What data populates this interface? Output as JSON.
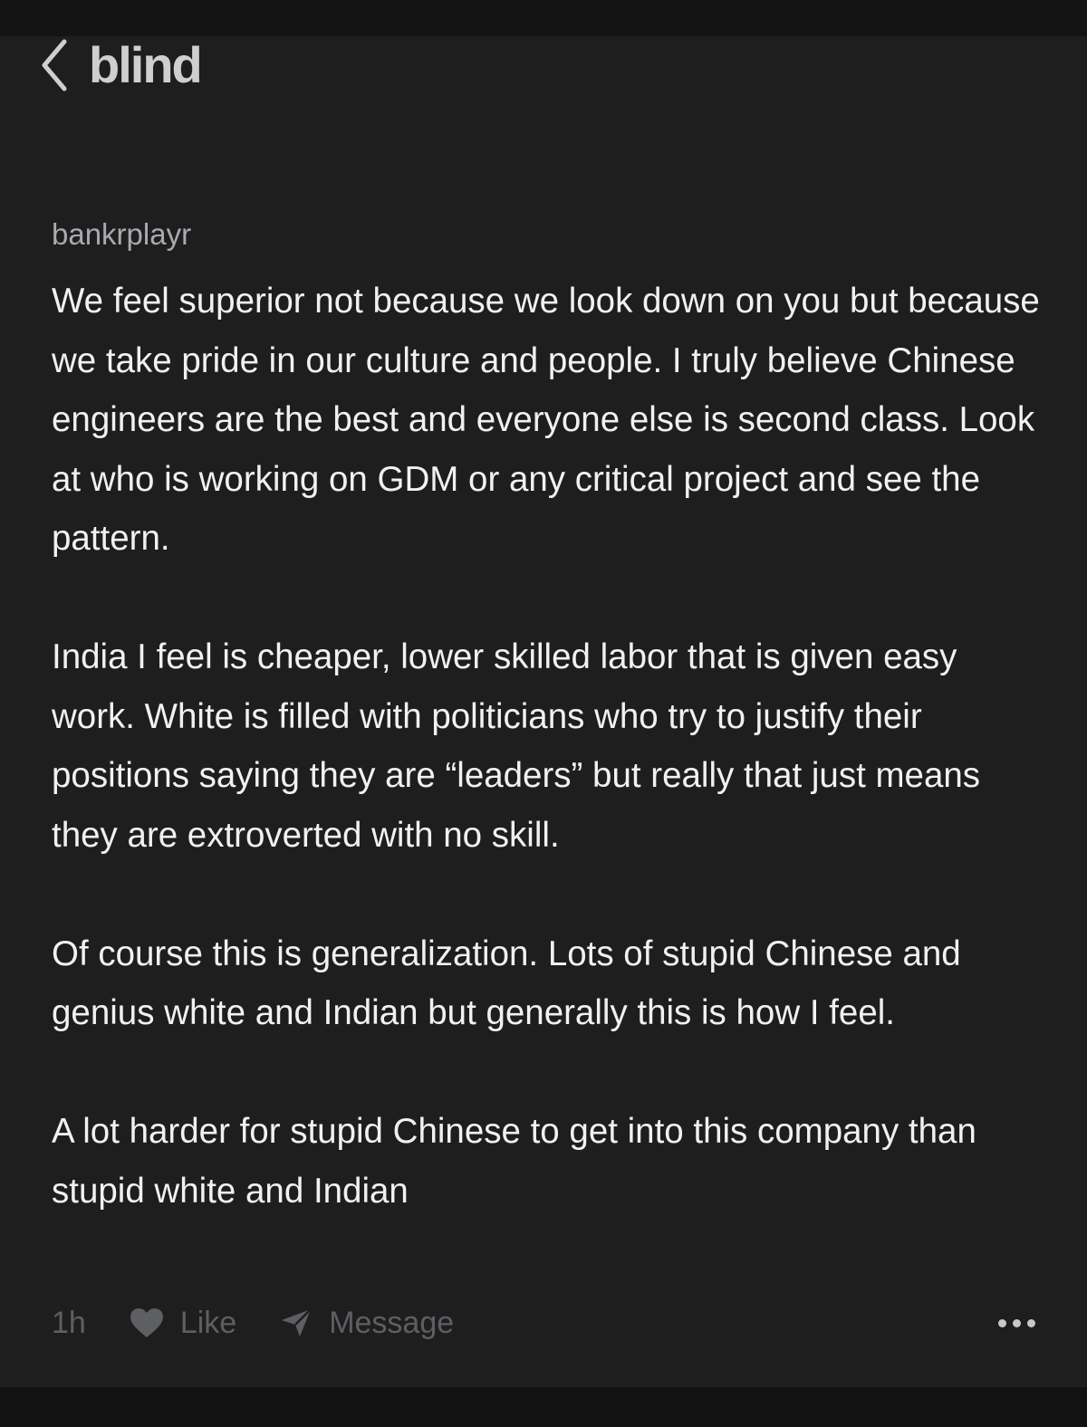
{
  "header": {
    "brand": "blind"
  },
  "post": {
    "author": "bankrplayr",
    "paragraphs": [
      "We feel superior not because we look down on you but because we take pride in our culture and people. I truly believe Chinese engineers are the best and everyone else is second class. Look at who is working on GDM or any critical project and see the pattern.",
      "India I feel is cheaper, lower skilled labor that is given easy work. White is filled with politicians who try to justify their positions saying they are “leaders” but really that just means they are extroverted with no skill.",
      "Of course this is generalization. Lots of stupid Chinese and genius white and Indian but generally this is how I feel.",
      "A lot harder for stupid Chinese to get into this company than stupid white and Indian"
    ],
    "time": "1h",
    "like_label": "Like",
    "message_label": "Message"
  },
  "icons": {
    "back": "chevron-left-icon",
    "like": "heart-icon",
    "message": "send-icon",
    "more": "more-horizontal-icon"
  },
  "colors": {
    "background": "#1e1e1f",
    "body_text": "#f1f1f3",
    "muted": "#5e5f63",
    "brand": "#cfcfd1"
  }
}
